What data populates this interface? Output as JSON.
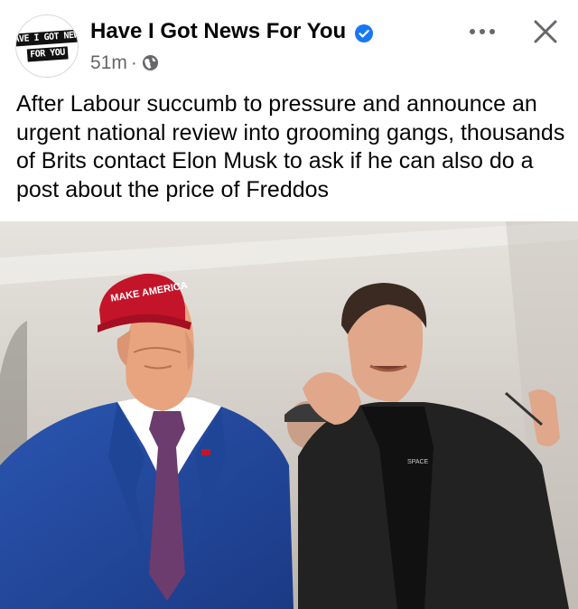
{
  "post": {
    "page_name": "Have I Got News For You",
    "avatar_text_line1": "HAVE I GOT NEWS",
    "avatar_text_line2": "FOR YOU",
    "timestamp": "51m",
    "separator": "·",
    "audience_icon": "globe-icon",
    "verified_icon": "verified-badge-icon",
    "text": "After Labour succumb to pressure and announce an urgent national review into grooming gangs, thousands of Brits contact Elon Musk to ask if he can also do a post about the price of Freddos",
    "image": {
      "hat_text": "MAKE AMERICA",
      "shirt_text": "SPACE"
    }
  },
  "colors": {
    "verified": "#1877f2",
    "name": "#050505",
    "meta": "#65676b",
    "hat": "#c4142a",
    "suit": "#23469a"
  }
}
